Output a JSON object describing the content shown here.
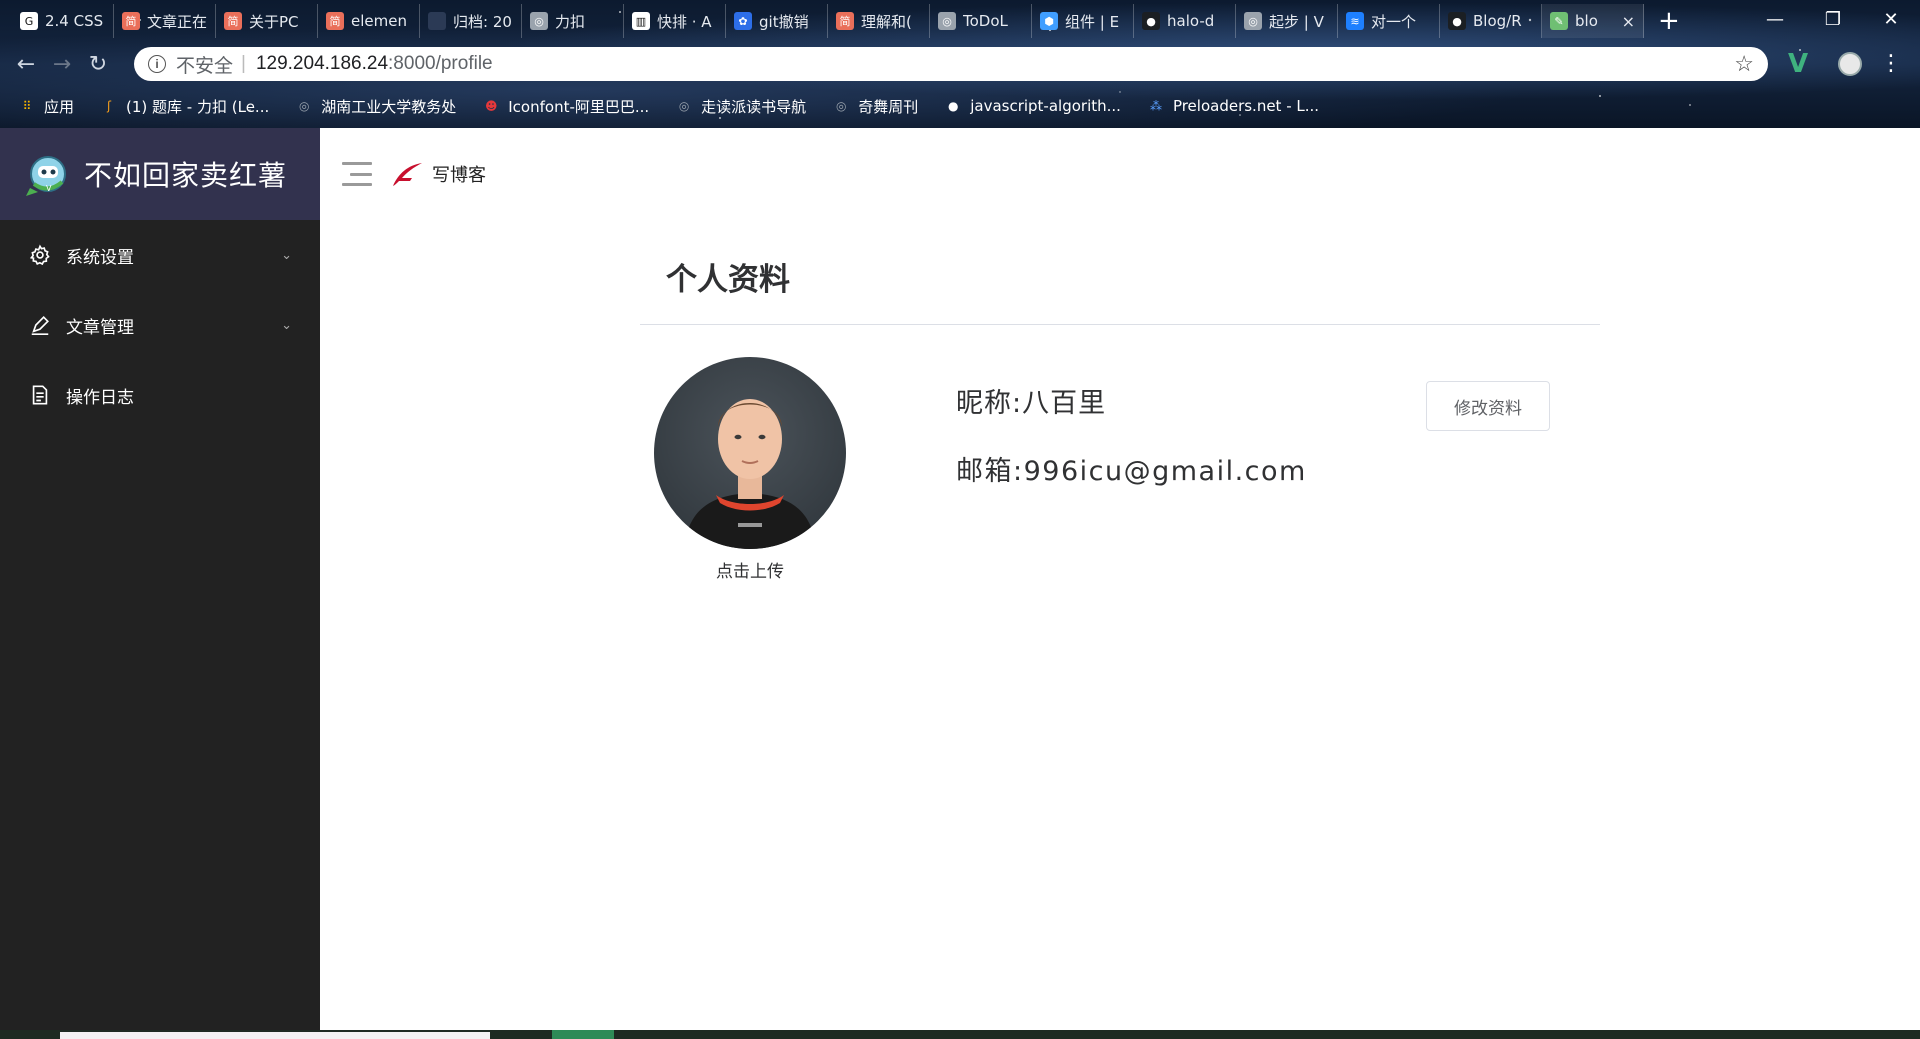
{
  "browser": {
    "tabs": [
      {
        "title": "2.4 CSS",
        "icon": "gc-icon",
        "color": "#ffffff"
      },
      {
        "title": "文章正在",
        "icon": "jianshu-icon",
        "color": "#ea6f5a"
      },
      {
        "title": "关于PC",
        "icon": "jianshu-icon",
        "color": "#ea6f5a"
      },
      {
        "title": "elemen",
        "icon": "jianshu-icon",
        "color": "#ea6f5a"
      },
      {
        "title": "归档: 20",
        "icon": "blank-icon",
        "color": "#2b3a55"
      },
      {
        "title": "力扣",
        "icon": "globe-icon",
        "color": "#9aa3ad"
      },
      {
        "title": "快排 · A",
        "icon": "book-icon",
        "color": "#ffffff"
      },
      {
        "title": "git撤销",
        "icon": "baidu-icon",
        "color": "#2d6ee8"
      },
      {
        "title": "理解和(",
        "icon": "jianshu-icon",
        "color": "#ea6f5a"
      },
      {
        "title": "ToDoL",
        "icon": "globe-icon",
        "color": "#9aa3ad"
      },
      {
        "title": "组件 | E",
        "icon": "hex-icon",
        "color": "#409eff"
      },
      {
        "title": "halo-d",
        "icon": "github-icon",
        "color": "#1b1f23"
      },
      {
        "title": "起步 | V",
        "icon": "globe-icon",
        "color": "#9aa3ad"
      },
      {
        "title": "对一个",
        "icon": "juejin-icon",
        "color": "#1e80ff"
      },
      {
        "title": "Blog/R",
        "icon": "github-icon",
        "color": "#1b1f23"
      },
      {
        "title": "blo",
        "icon": "blog-icon",
        "color": "#6fbf73",
        "active": true
      }
    ],
    "address": {
      "security": "不安全",
      "host": "129.204.186.24",
      "path": ":8000/profile"
    },
    "bookmarks": [
      {
        "label": "应用",
        "icon": "apps-grid-icon"
      },
      {
        "label": "(1) 题库 - 力扣 (Le...",
        "icon": "leetcode-icon"
      },
      {
        "label": "湖南工业大学教务处",
        "icon": "globe-icon"
      },
      {
        "label": "Iconfont-阿里巴巴...",
        "icon": "iconfont-icon"
      },
      {
        "label": "走读派读书导航",
        "icon": "globe-icon"
      },
      {
        "label": "奇舞周刊",
        "icon": "globe-icon"
      },
      {
        "label": "javascript-algorith...",
        "icon": "github-icon"
      },
      {
        "label": "Preloaders.net - L...",
        "icon": "preloader-icon"
      }
    ]
  },
  "sidebar": {
    "brand": "不如回家卖红薯",
    "items": [
      {
        "label": "系统设置",
        "icon": "gear-icon",
        "expandable": true
      },
      {
        "label": "文章管理",
        "icon": "edit-icon",
        "expandable": true
      },
      {
        "label": "操作日志",
        "icon": "document-icon",
        "expandable": false
      }
    ]
  },
  "topbar": {
    "write_label": "写博客"
  },
  "profile": {
    "title": "个人资料",
    "upload_label": "点击上传",
    "nickname": "昵称:八百里",
    "email": "邮箱:996icu@gmail.com",
    "edit_button": "修改资料"
  },
  "colors": {
    "sidebar_bg": "#222222",
    "brand_bg": "#32324e",
    "accent_red": "#c8102e"
  }
}
